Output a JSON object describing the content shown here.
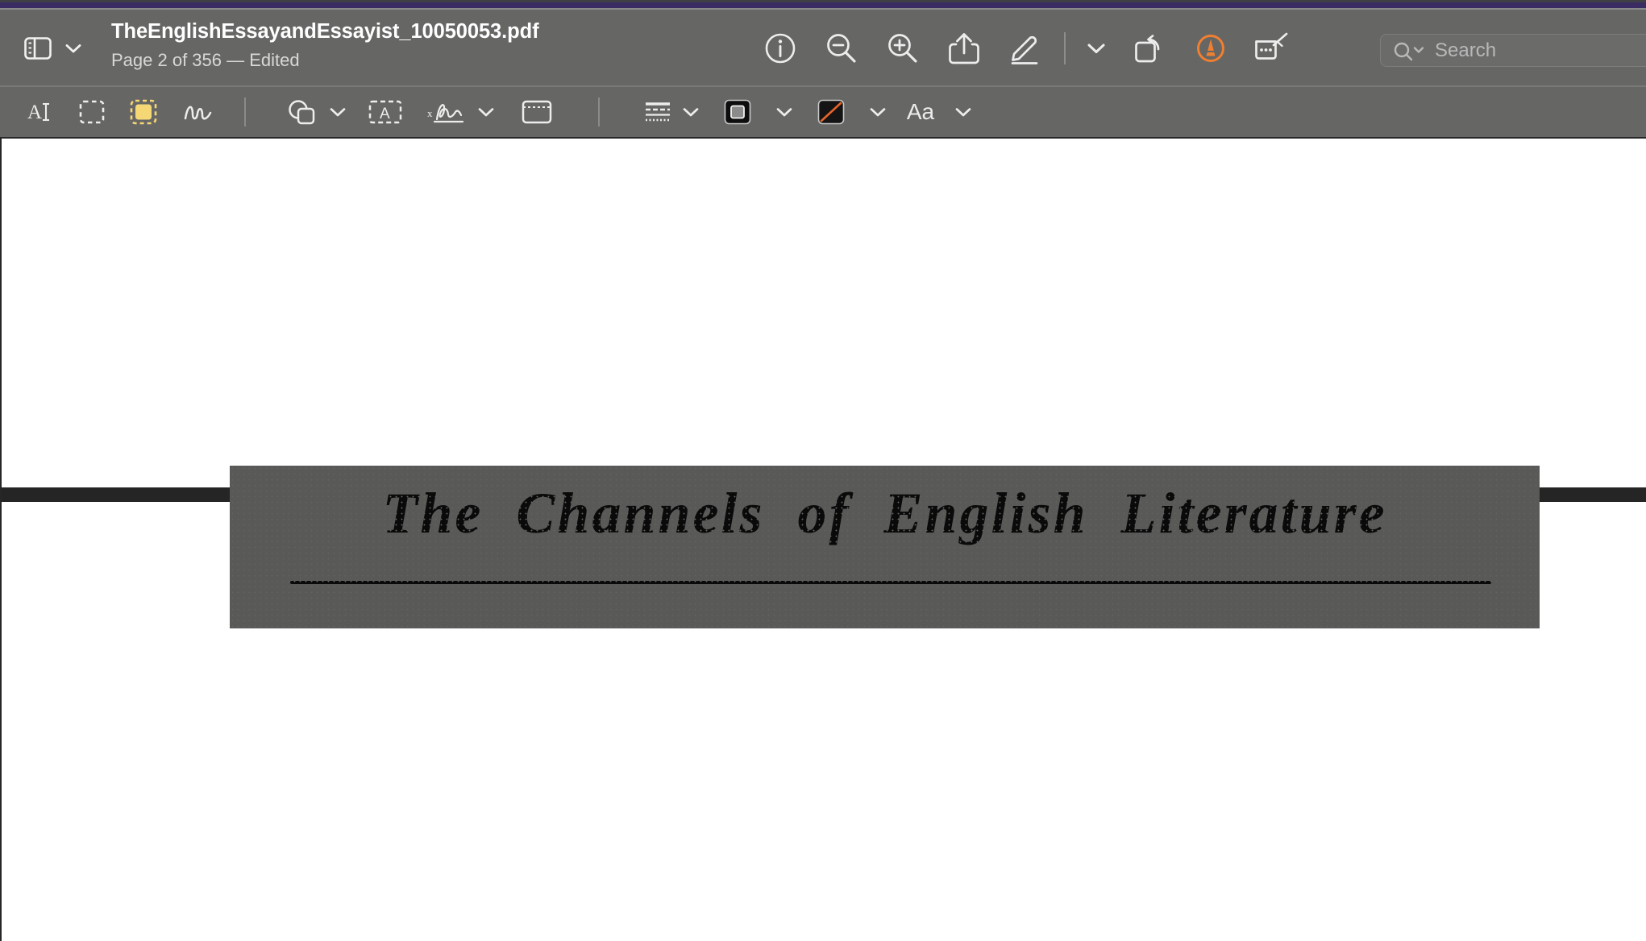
{
  "window": {
    "accent_strip_color": "#3b2b63",
    "toolbar_bg": "#666665"
  },
  "toolbar": {
    "sidebar_toggle_label": "sidebar-toggle",
    "sidebar_chevron_label": "chevron-down",
    "document_title": "TheEnglishEssayandEssayist_10050053.pdf",
    "document_subtitle": "Page 2 of 356 — Edited",
    "buttons": [
      {
        "name": "info-button",
        "icon": "info-circle-icon",
        "label": "Info"
      },
      {
        "name": "zoom-out-button",
        "icon": "magnifier-minus-icon",
        "label": "Zoom Out"
      },
      {
        "name": "zoom-in-button",
        "icon": "magnifier-plus-icon",
        "label": "Zoom In"
      },
      {
        "name": "share-button",
        "icon": "share-up-arrow-icon",
        "label": "Share"
      },
      {
        "name": "markup-button",
        "icon": "pencil-underline-icon",
        "label": "Show Markup Toolbar"
      },
      {
        "name": "markup-options-button",
        "icon": "chevron-down-icon",
        "label": "Markup Options"
      },
      {
        "name": "rotate-button",
        "icon": "rotate-left-icon",
        "label": "Rotate Left"
      },
      {
        "name": "highlight-button",
        "icon": "orange-highlight-circle-icon",
        "label": "Highlight"
      },
      {
        "name": "annotate-button",
        "icon": "note-pencil-icon",
        "label": "Annotate"
      }
    ],
    "highlight_accent_color": "#ef7f31"
  },
  "search": {
    "placeholder": "Search",
    "icon": "search-magnifier-chevron-icon",
    "value": ""
  },
  "markup_toolbar": {
    "tools": [
      {
        "name": "text-selection-tool",
        "icon": "text-cursor-icon",
        "label": "Text Selection",
        "active": false
      },
      {
        "name": "rectangular-selection-tool",
        "icon": "dashed-rectangle-icon",
        "label": "Rectangular Selection",
        "active": false
      },
      {
        "name": "highlight-selection-tool",
        "icon": "filled-yellow-selection-icon",
        "label": "Highlight Selection",
        "active": true
      },
      {
        "name": "sketch-tool",
        "icon": "scribble-icon",
        "label": "Sketch",
        "active": false
      },
      {
        "name": "shapes-tool",
        "icon": "shapes-overlap-icon",
        "label": "Shapes",
        "active": false
      },
      {
        "name": "shapes-chevron",
        "icon": "chevron-down-icon",
        "label": "Shapes Menu",
        "active": false
      },
      {
        "name": "text-box-tool",
        "icon": "text-box-a-icon",
        "label": "Text",
        "active": false
      },
      {
        "name": "signature-tool",
        "icon": "signature-icon",
        "label": "Sign",
        "active": false
      },
      {
        "name": "signature-chevron",
        "icon": "chevron-down-icon",
        "label": "Signature Menu",
        "active": false
      },
      {
        "name": "note-tool",
        "icon": "note-window-icon",
        "label": "Note",
        "active": false
      },
      {
        "name": "line-style-tool",
        "icon": "stacked-lines-icon",
        "label": "Shape Style",
        "active": false
      },
      {
        "name": "line-style-chevron",
        "icon": "chevron-down-icon",
        "label": "Shape Style Menu",
        "active": false
      },
      {
        "name": "border-color-tool",
        "icon": "black-square-swatch-icon",
        "label": "Border Color",
        "active": false
      },
      {
        "name": "border-color-chevron",
        "icon": "chevron-down-icon",
        "label": "Border Color Menu",
        "active": false
      },
      {
        "name": "fill-color-tool",
        "icon": "no-fill-diagonal-swatch-icon",
        "label": "Fill Color",
        "active": false
      },
      {
        "name": "fill-color-chevron",
        "icon": "chevron-down-icon",
        "label": "Fill Color Menu",
        "active": false
      },
      {
        "name": "font-style-tool",
        "icon": "aa-text-icon",
        "label": "Aa",
        "active": false
      },
      {
        "name": "font-style-chevron",
        "icon": "chevron-down-icon",
        "label": "Font Menu",
        "active": false
      }
    ],
    "font_button_label": "Aa",
    "active_tool_color": "#f6d776",
    "no_fill_slash_color": "#e8642a"
  },
  "document": {
    "page_background": "#ffffff",
    "page_gap_color": "#252525",
    "selection": {
      "band_color": "#595958",
      "heading_text": "The Channels of English Literature",
      "has_underline_rule": true
    }
  }
}
